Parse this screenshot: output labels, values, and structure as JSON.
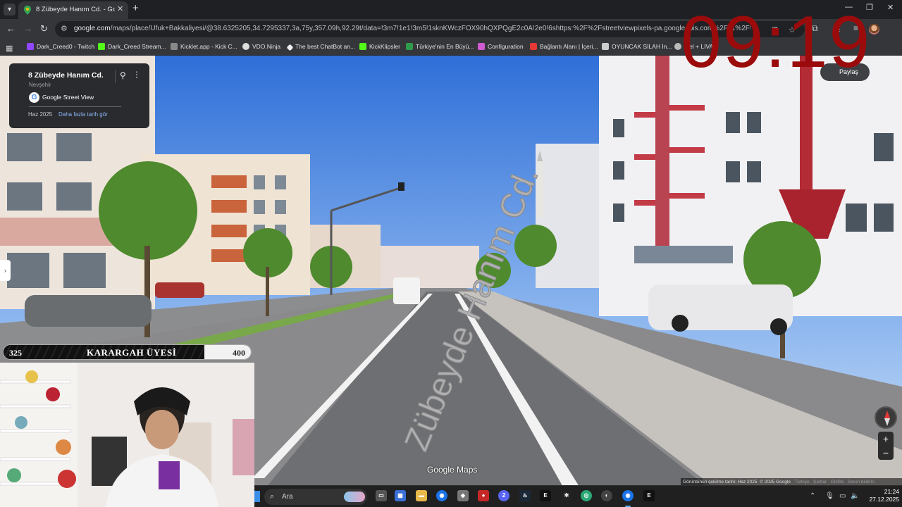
{
  "browser": {
    "tab_title": "8 Zübeyde Hanım Cd. - Google",
    "url_host": "google.com",
    "url_path": "/maps/place/Ufuk+Bakkaliyesi/@38.6325205,34.7295337,3a,75y,357.09h,92.29t/data=!3m7!1e1!3m5!1sknKWczFOX90hQXPQgE2c0A!2e0!6shttps:%2F%2Fstreetviewpixels-pa.googleapis.com%2Fv1%2Fthumbnail?cb_client%3..."
  },
  "bookmarks": [
    {
      "label": "Dark_Creed0 - Twitch",
      "color": "#9146ff"
    },
    {
      "label": "Dark_Creed Stream...",
      "color": "#53fc18"
    },
    {
      "label": "Kicklet.app - Kick C...",
      "color": "#888888"
    },
    {
      "label": "VDO.Ninja",
      "color": "#dddddd"
    },
    {
      "label": "The best ChatBot an...",
      "color": "#eeeeee"
    },
    {
      "label": "KickKlipsler",
      "color": "#53fc18"
    },
    {
      "label": "Türkiye'nin En Büyü...",
      "color": "#2e9c4c"
    },
    {
      "label": "Configuration",
      "color": "#d05bd0"
    },
    {
      "label": "Bağlantı Alanı | İçeri...",
      "color": "#e53935"
    },
    {
      "label": "OYUNCAK SİLAH İn...",
      "color": "#cccccc"
    },
    {
      "label": "...el + LIVAD",
      "color": "#bbbbbb"
    }
  ],
  "placecard": {
    "name": "8 Zübeyde Hanım Cd.",
    "city": "Nevşehir",
    "provider": "Google Street View",
    "date": "Haz 2025",
    "more_dates": "Daha fazla tarih gör"
  },
  "share_label": "Paylaş",
  "overlay_clock": "09:19",
  "road_label": "Zübeyde Hanım Cd.",
  "watermark": "Google Maps",
  "footer": {
    "capture": "Görüntünün çekilme tarihi: Haz 2025",
    "copyright": "© 2025 Google",
    "links": [
      "Türkiye",
      "Şartlar",
      "Gizlilik",
      "Sorun bildirin"
    ]
  },
  "stream_goal": {
    "current": "325",
    "label": "KARARGAH ÜYESİ",
    "target": "400",
    "progress_fraction": 0.8125
  },
  "taskbar": {
    "search_placeholder": "Ara",
    "time": "21:24",
    "date": "27.12.2025",
    "discord_badge": "2"
  }
}
